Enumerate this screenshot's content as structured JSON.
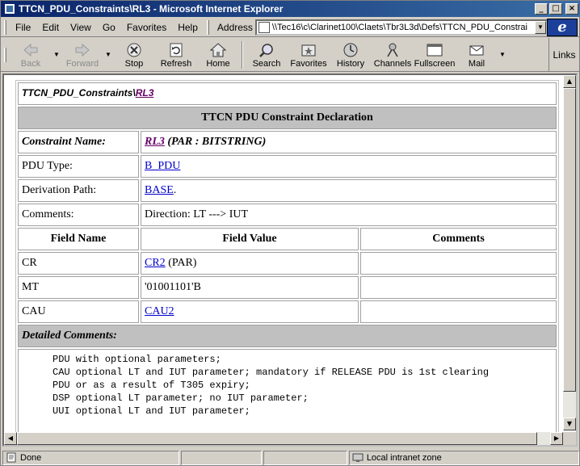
{
  "window": {
    "title": "TTCN_PDU_Constraints\\RL3 - Microsoft Internet Explorer",
    "controls": {
      "minimize": "_",
      "maximize": "□",
      "close": "×"
    }
  },
  "menu": [
    {
      "label": "File"
    },
    {
      "label": "Edit"
    },
    {
      "label": "View"
    },
    {
      "label": "Go"
    },
    {
      "label": "Favorites"
    },
    {
      "label": "Help"
    }
  ],
  "address": {
    "label": "Address",
    "value": "\\\\Tec16\\c\\Clarinet100\\Claets\\Tbr3L3d\\Defs\\TTCN_PDU_Constrai"
  },
  "ie_logo": "e",
  "toolbar": {
    "back": "Back",
    "forward": "Forward",
    "stop": "Stop",
    "refresh": "Refresh",
    "home": "Home",
    "search": "Search",
    "favorites": "Favorites",
    "history": "History",
    "channels": "Channels",
    "fullscreen": "Fullscreen",
    "mail": "Mail",
    "links": "Links"
  },
  "breadcrumb": {
    "parent": "TTCN_PDU_Constraints",
    "sep": "\\",
    "current": "RL3"
  },
  "table": {
    "heading": "TTCN PDU Constraint Declaration",
    "constraint_label": "Constraint Name:",
    "constraint_link": "RL3",
    "constraint_rest": " (PAR : BITSTRING)",
    "pdu_type_label": "PDU Type:",
    "pdu_type_value": "B_PDU",
    "derivation_label": "Derivation Path:",
    "derivation_value": "BASE",
    "derivation_suffix": ".",
    "comments_label": "Comments:",
    "comments_value": "Direction: LT ---> IUT",
    "col_field_name": "Field Name",
    "col_field_value": "Field Value",
    "col_comments": "Comments",
    "rows": [
      {
        "name": "CR",
        "link": "CR2",
        "rest": " (PAR)",
        "comment": ""
      },
      {
        "name": "MT",
        "link": "",
        "rest": "'01001101'B",
        "comment": ""
      },
      {
        "name": "CAU",
        "link": "CAU2",
        "rest": "",
        "comment": ""
      }
    ],
    "detailed_label": "Detailed Comments:",
    "detailed_text": "PDU with optional parameters;\nCAU optional LT and IUT parameter; mandatory if RELEASE PDU is 1st clearing\nPDU or as a result of T305 expiry;\nDSP optional LT parameter; no IUT parameter;\nUUI optional LT and IUT parameter;"
  },
  "status": {
    "text": "Done",
    "zone": "Local intranet zone"
  }
}
